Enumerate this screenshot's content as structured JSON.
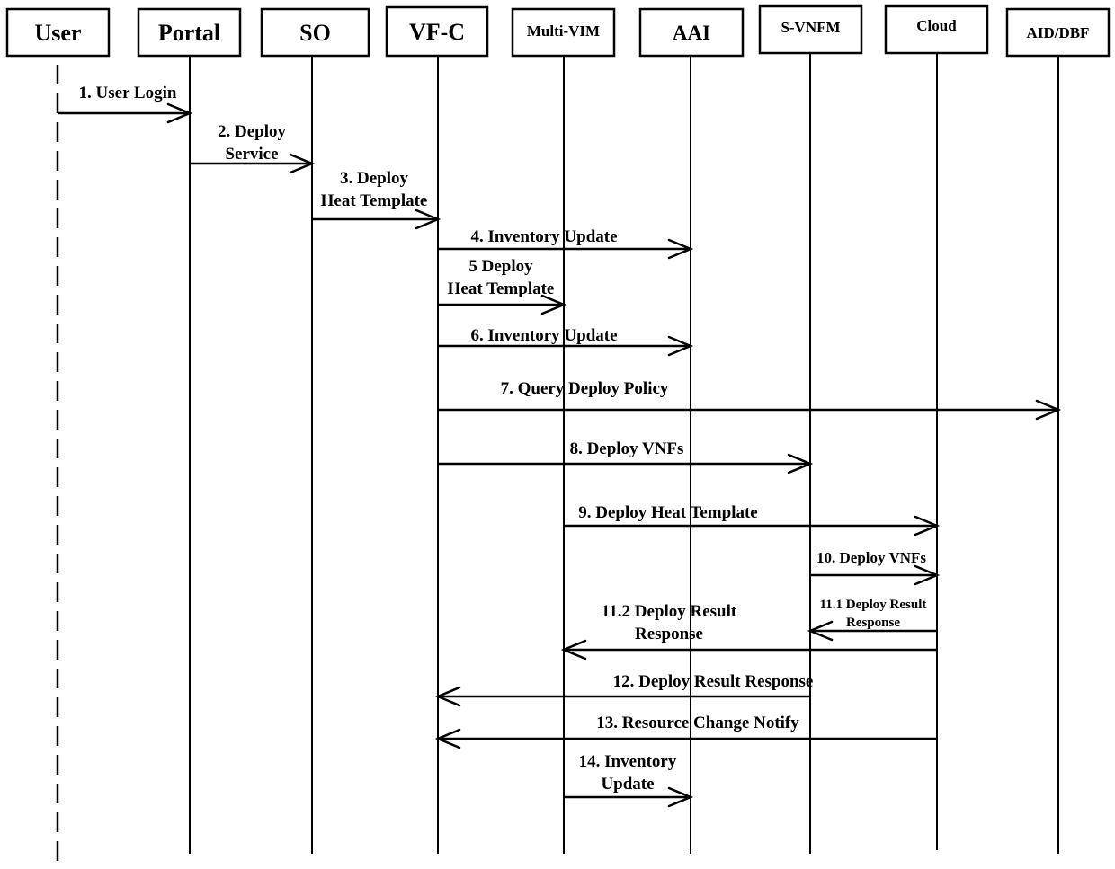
{
  "diagram": {
    "type": "sequence",
    "participants": [
      {
        "id": "user",
        "label": "User",
        "lifeline": "dashed",
        "font": "large"
      },
      {
        "id": "portal",
        "label": "Portal",
        "lifeline": "solid",
        "font": "large"
      },
      {
        "id": "so",
        "label": "SO",
        "lifeline": "solid",
        "font": "large"
      },
      {
        "id": "vfc",
        "label": "VF-C",
        "lifeline": "solid",
        "font": "large"
      },
      {
        "id": "multivim",
        "label": "Multi-VIM",
        "lifeline": "solid",
        "font": "small"
      },
      {
        "id": "aai",
        "label": "AAI",
        "lifeline": "solid",
        "font": "large-mid"
      },
      {
        "id": "svnfm",
        "label": "S-VNFM",
        "lifeline": "solid",
        "font": "small"
      },
      {
        "id": "cloud",
        "label": "Cloud",
        "lifeline": "solid",
        "font": "small"
      },
      {
        "id": "aiddbf",
        "label": "AID/DBF",
        "lifeline": "solid",
        "font": "small"
      }
    ],
    "messages": [
      {
        "step": "1",
        "from": "user",
        "to": "portal",
        "lines": [
          "1. User Login"
        ]
      },
      {
        "step": "2",
        "from": "portal",
        "to": "so",
        "lines": [
          "2. Deploy",
          "Service"
        ]
      },
      {
        "step": "3",
        "from": "so",
        "to": "vfc",
        "lines": [
          "3. Deploy",
          "Heat Template"
        ]
      },
      {
        "step": "4",
        "from": "vfc",
        "to": "aai",
        "lines": [
          "4. Inventory Update"
        ]
      },
      {
        "step": "5",
        "from": "vfc",
        "to": "multivim",
        "lines": [
          "5 Deploy",
          "Heat Template"
        ]
      },
      {
        "step": "6",
        "from": "vfc",
        "to": "aai",
        "lines": [
          "6. Inventory Update"
        ]
      },
      {
        "step": "7",
        "from": "vfc",
        "to": "aiddbf",
        "lines": [
          "7. Query Deploy Policy"
        ]
      },
      {
        "step": "8",
        "from": "vfc",
        "to": "svnfm",
        "lines": [
          "8. Deploy VNFs"
        ]
      },
      {
        "step": "9",
        "from": "multivim",
        "to": "cloud",
        "lines": [
          "9. Deploy Heat Template"
        ]
      },
      {
        "step": "10",
        "from": "svnfm",
        "to": "cloud",
        "lines": [
          "10. Deploy VNFs"
        ]
      },
      {
        "step": "11.1",
        "from": "cloud",
        "to": "svnfm",
        "lines": [
          "11.1 Deploy Result",
          "Response"
        ]
      },
      {
        "step": "11.2",
        "from": "cloud",
        "to": "multivim",
        "lines": [
          "11.2 Deploy Result",
          "Response"
        ]
      },
      {
        "step": "12",
        "from": "svnfm",
        "to": "vfc",
        "lines": [
          "12. Deploy Result Response"
        ]
      },
      {
        "step": "13",
        "from": "cloud",
        "to": "vfc",
        "lines": [
          "13. Resource Change Notify"
        ]
      },
      {
        "step": "14",
        "from": "multivim",
        "to": "aai",
        "lines": [
          "14. Inventory",
          "Update"
        ]
      }
    ]
  }
}
